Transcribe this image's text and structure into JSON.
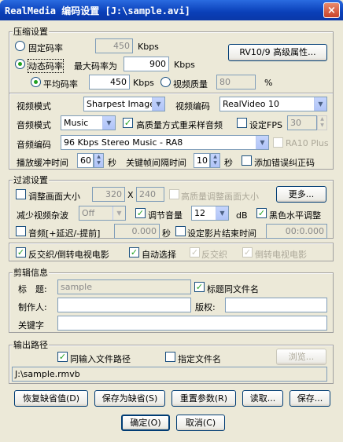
{
  "window": {
    "title": "RealMedia 编码设置 [J:\\sample.avi]",
    "close_glyph": "×"
  },
  "compress": {
    "group_label": "压缩设置",
    "cbr_label": "固定码率",
    "cbr_value": "450",
    "cbr_unit": "Kbps",
    "advanced_button": "RV10/9 高级属性...",
    "vbr_label": "动态码率",
    "max_rate_label": "最大码率为",
    "max_rate_value": "900",
    "max_rate_unit": "Kbps",
    "avg_label": "平均码率",
    "avg_value": "450",
    "avg_unit": "Kbps",
    "quality_label": "视频质量",
    "quality_value": "80",
    "quality_unit": "%"
  },
  "video": {
    "mode_label": "视频模式",
    "mode_value": "Sharpest Image",
    "codec_label": "视频编码",
    "codec_value": "RealVideo 10",
    "audio_mode_label": "音频模式",
    "audio_mode_value": "Music",
    "hq_resample_label": "高质量方式重采样音频",
    "fps_label": "设定FPS",
    "fps_value": "30",
    "audio_codec_label": "音频编码",
    "audio_codec_value": "96 Kbps Stereo Music - RA8",
    "ra10_label": "RA10 Plus",
    "buffer_label": "播放缓冲时间",
    "buffer_value": "60",
    "buffer_unit": "秒",
    "keyframe_label": "关键帧间隔时间",
    "keyframe_value": "10",
    "keyframe_unit": "秒",
    "error_correct_label": "添加错误纠正码"
  },
  "filter": {
    "group_label": "过滤设置",
    "resize_label": "调整画面大小",
    "width_value": "320",
    "x_sep": "X",
    "height_value": "240",
    "hq_resize_label": "高质量调整画面大小",
    "more_button": "更多...",
    "denoise_label": "减少视频杂波",
    "denoise_value": "Off",
    "volume_label": "调节音量",
    "volume_value": "12",
    "volume_unit": "dB",
    "black_level_label": "黑色水平调整",
    "audio_delay_label": "音频[+延迟/-提前]",
    "delay_value": "0.000",
    "delay_unit": "秒",
    "end_time_label": "设定影片结束时间",
    "end_time_value": "00:0.000"
  },
  "deinterlace": {
    "deinterlace_label": "反交织/倒转电视电影",
    "auto_label": "自动选择",
    "deint_only_label": "反交织",
    "telecine_label": "倒转电视电影"
  },
  "clip": {
    "group_label": "剪辑信息",
    "title_label": "标　题:",
    "title_value": "sample",
    "same_as_file_label": "标题同文件名",
    "author_label": "制作人:",
    "author_value": "",
    "copyright_label": "版权:",
    "copyright_value": "",
    "keywords_label": "关键字",
    "keywords_value": ""
  },
  "output": {
    "group_label": "输出路径",
    "same_path_label": "同输入文件路径",
    "specify_name_label": "指定文件名",
    "browse_button": "浏览...",
    "path_value": "J:\\sample.rmvb"
  },
  "buttons": {
    "restore": "恢复缺省值(D)",
    "save_default": "保存为缺省(S)",
    "reset": "重置参数(R)",
    "load": "读取...",
    "save": "保存...",
    "ok": "确定(O)",
    "cancel": "取消(C)"
  },
  "icons": {
    "check": "✓",
    "dropdown": "▼",
    "spin_up": "▲",
    "spin_down": "▼"
  }
}
